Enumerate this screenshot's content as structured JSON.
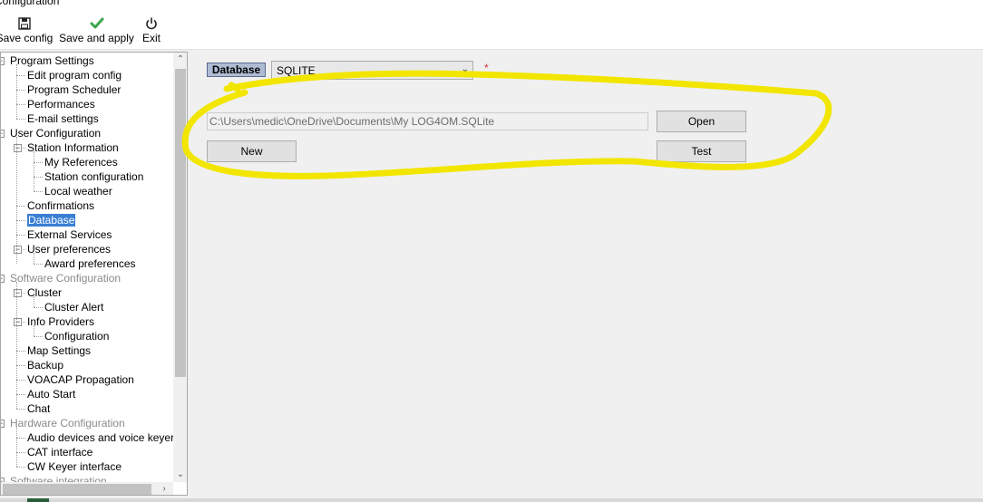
{
  "window": {
    "title": "Configuration"
  },
  "toolbar": {
    "buttons": [
      {
        "label": "Save config",
        "icon": "floppy-disk-icon"
      },
      {
        "label": "Save and apply",
        "icon": "checkmark-icon"
      },
      {
        "label": "Exit",
        "icon": "power-icon"
      }
    ]
  },
  "tree": {
    "nodes": [
      "Program Settings",
      "Edit program config",
      "Program Scheduler",
      "Performances",
      "E-mail settings",
      "User Configuration",
      "Station Information",
      "My References",
      "Station configuration",
      "Local weather",
      "Confirmations",
      "Database",
      "External Services",
      "User preferences",
      "Award preferences",
      "Software Configuration",
      "Cluster",
      "Cluster Alert",
      "Info Providers",
      "Configuration",
      "Map Settings",
      "Backup",
      "VOACAP Propagation",
      "Auto Start",
      "Chat",
      "Hardware Configuration",
      "Audio devices and voice keyer",
      "CAT interface",
      "CW Keyer interface",
      "Software integration"
    ],
    "selected": "Database"
  },
  "database": {
    "label": "Database",
    "type_value": "SQLITE",
    "required_mark": "*",
    "path": "C:\\Users\\medic\\OneDrive\\Documents\\My LOG4OM.SQLite",
    "open_label": "Open",
    "new_label": "New",
    "test_label": "Test"
  },
  "annotation": {
    "color": "#f2e600"
  }
}
